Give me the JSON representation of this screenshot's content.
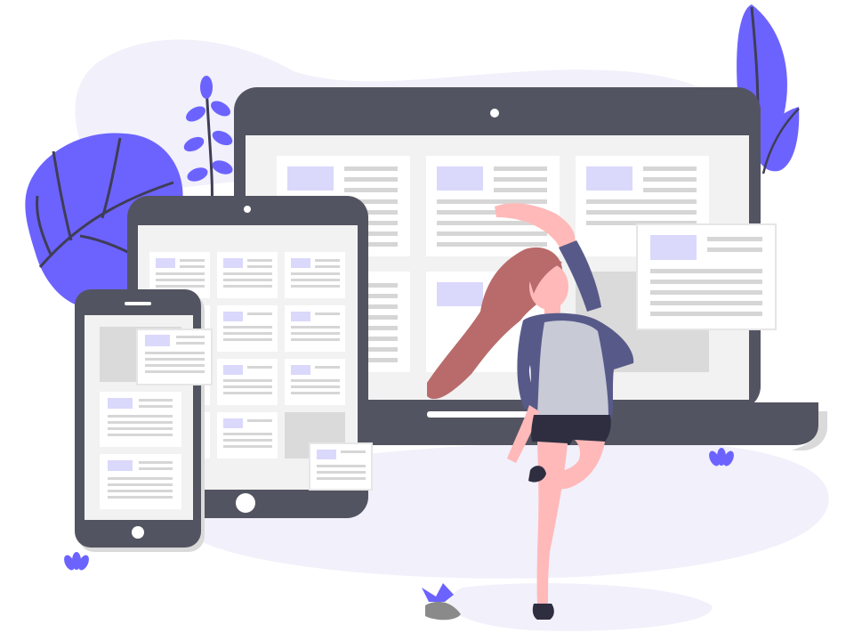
{
  "illustration": {
    "subject": "responsive-design",
    "devices": [
      "laptop",
      "tablet",
      "phone"
    ],
    "figure": "dancing-woman"
  },
  "colors": {
    "background": "#ffffff",
    "blob": "#f1f0fb",
    "accent": "#6c63ff",
    "accent_light": "#dad8fb",
    "device_frame": "#535461",
    "device_frame_dark": "#3f3d56",
    "screen": "#f2f2f2",
    "card": "#ffffff",
    "text_line": "#d6d6d6",
    "image_block": "#dadada",
    "hair": "#b96b6b",
    "skin": "#ffb9b9",
    "jacket": "#575a89",
    "shirt": "#c8cad6",
    "shorts": "#2f2e41"
  }
}
